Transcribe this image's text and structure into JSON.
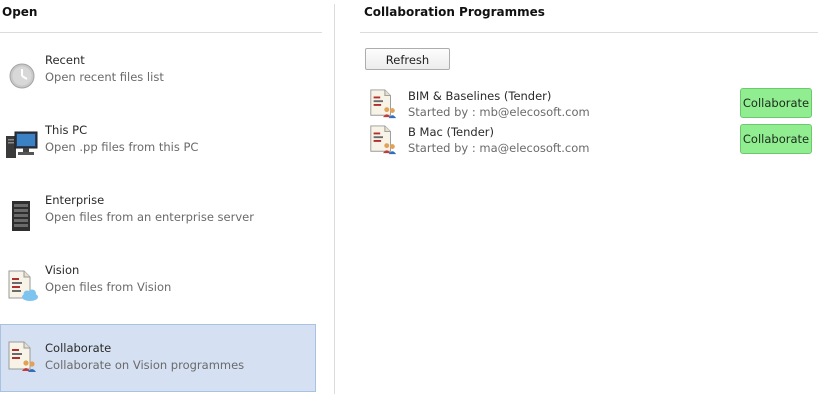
{
  "left": {
    "title": "Open",
    "items": [
      {
        "title": "Recent",
        "desc": "Open recent files list",
        "icon": "clock-icon"
      },
      {
        "title": "This PC",
        "desc": "Open .pp files from this PC",
        "icon": "computer-icon"
      },
      {
        "title": "Enterprise",
        "desc": "Open files from an enterprise server",
        "icon": "server-icon"
      },
      {
        "title": "Vision",
        "desc": "Open files from Vision",
        "icon": "cloud-document-icon"
      },
      {
        "title": "Collaborate",
        "desc": "Collaborate on Vision programmes",
        "icon": "collaborate-document-icon",
        "selected": true
      }
    ]
  },
  "right": {
    "title": "Collaboration Programmes",
    "refresh_label": "Refresh",
    "programmes": [
      {
        "name": "BIM & Baselines (Tender)",
        "started": "Started by : mb@elecosoft.com",
        "button": "Collaborate"
      },
      {
        "name": "B Mac (Tender)",
        "started": "Started by : ma@elecosoft.com",
        "button": "Collaborate"
      }
    ]
  },
  "colors": {
    "selected_bg": "#d5e1f2",
    "collaborate_button": "#90ee90"
  }
}
